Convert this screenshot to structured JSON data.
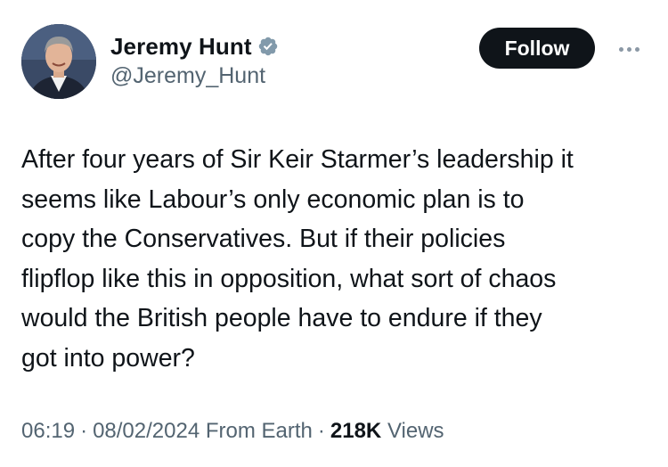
{
  "author": {
    "display_name": "Jeremy Hunt",
    "handle": "@Jeremy_Hunt",
    "verified_icon": "verified-badge-icon",
    "verified_color": "#829aab"
  },
  "actions": {
    "follow_label": "Follow",
    "more_icon": "more-options-icon"
  },
  "tweet": {
    "text": "After four years of Sir Keir Starmer’s leadership it\nseems like Labour’s only economic plan is to\ncopy the Conservatives. But if their policies\nflipflop like this in opposition, what sort of chaos\nwould the British people have to endure if they\ngot into power?"
  },
  "meta": {
    "time": "06:19",
    "separator": "·",
    "date": "08/02/2024",
    "location": "From Earth",
    "views_count": "218K",
    "views_label": "Views"
  },
  "colors": {
    "text": "#0f1419",
    "secondary_text": "#536471",
    "follow_bg": "#0f1419",
    "follow_text": "#ffffff"
  }
}
